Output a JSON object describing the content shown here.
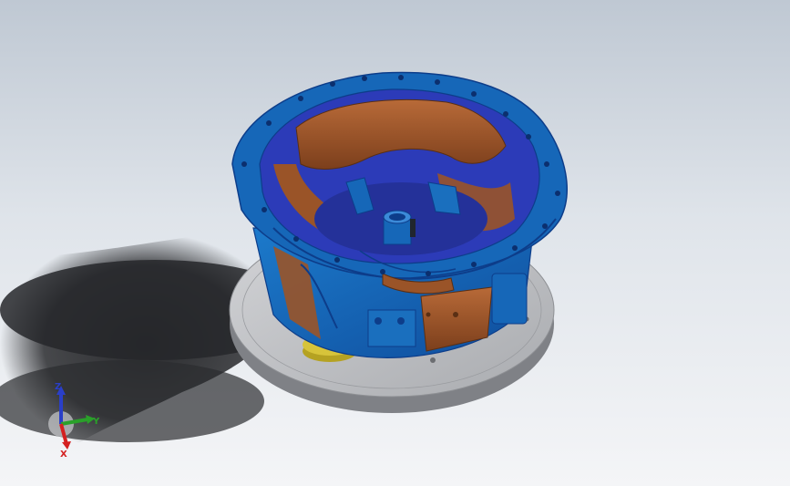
{
  "viewport": {
    "background_top": "#bfc8d3",
    "background_bottom": "#f4f5f7"
  },
  "model": {
    "colors": {
      "housing_blue": "#1667b8",
      "housing_dark_blue": "#0d3d8a",
      "inner_violet": "#2c3bb8",
      "inner_copper": "#9a5428",
      "copper_light": "#c07040",
      "fixture_plate": "#c9cacd",
      "fixture_edge": "#8e9094",
      "brass_ring": "#d7c43a",
      "shadow": "#1f2023"
    }
  },
  "triad": {
    "x_label": "X",
    "y_label": "Y",
    "z_label": "Z",
    "x_color": "#d42020",
    "y_color": "#2aa02a",
    "z_color": "#2a3fc8"
  }
}
